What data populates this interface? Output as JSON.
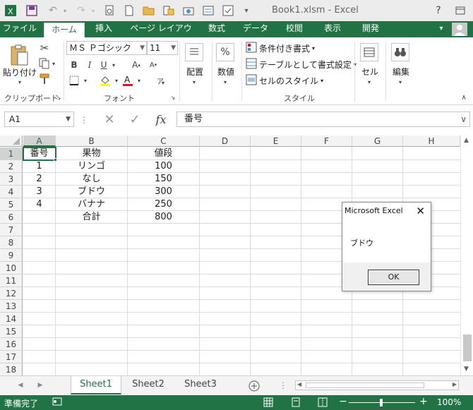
{
  "window": {
    "title": "Book1.xlsm - Excel"
  },
  "ribbon_tabs": [
    "ファイル",
    "ホーム",
    "挿入",
    "ページ レイアウト",
    "数式",
    "データ",
    "校閲",
    "表示",
    "開発"
  ],
  "ribbon": {
    "clipboard": {
      "paste_label": "貼り付け",
      "group_label": "クリップボード"
    },
    "font": {
      "font_name": "ＭＳ Ｐゴシック",
      "font_size": "11",
      "group_label": "フォント"
    },
    "alignment": {
      "label": "配置"
    },
    "number": {
      "label": "数値"
    },
    "styles": {
      "conditional": "条件付き書式",
      "table": "テーブルとして書式設定",
      "cell_styles": "セルのスタイル",
      "group_label": "スタイル"
    },
    "cells": {
      "label": "セル"
    },
    "editing": {
      "label": "編集"
    }
  },
  "formula_bar": {
    "name_box": "A1",
    "fx": "fx",
    "content": "番号"
  },
  "grid": {
    "columns": [
      "A",
      "B",
      "C",
      "D",
      "E",
      "F",
      "G",
      "H"
    ],
    "rows": [
      "1",
      "2",
      "3",
      "4",
      "5",
      "6",
      "7",
      "8",
      "9",
      "10",
      "11",
      "12",
      "13",
      "14",
      "15",
      "16",
      "17",
      "18"
    ],
    "cells": [
      [
        "番号",
        "果物",
        "値段"
      ],
      [
        "1",
        "リンゴ",
        "100"
      ],
      [
        "2",
        "なし",
        "150"
      ],
      [
        "3",
        "ブドウ",
        "300"
      ],
      [
        "4",
        "バナナ",
        "250"
      ],
      [
        "",
        "合計",
        "800"
      ]
    ]
  },
  "sheets": [
    "Sheet1",
    "Sheet2",
    "Sheet3"
  ],
  "status": {
    "ready": "準備完了",
    "zoom": "100%"
  },
  "msgbox": {
    "title": "Microsoft Excel",
    "message": "ブドウ",
    "ok": "OK"
  }
}
